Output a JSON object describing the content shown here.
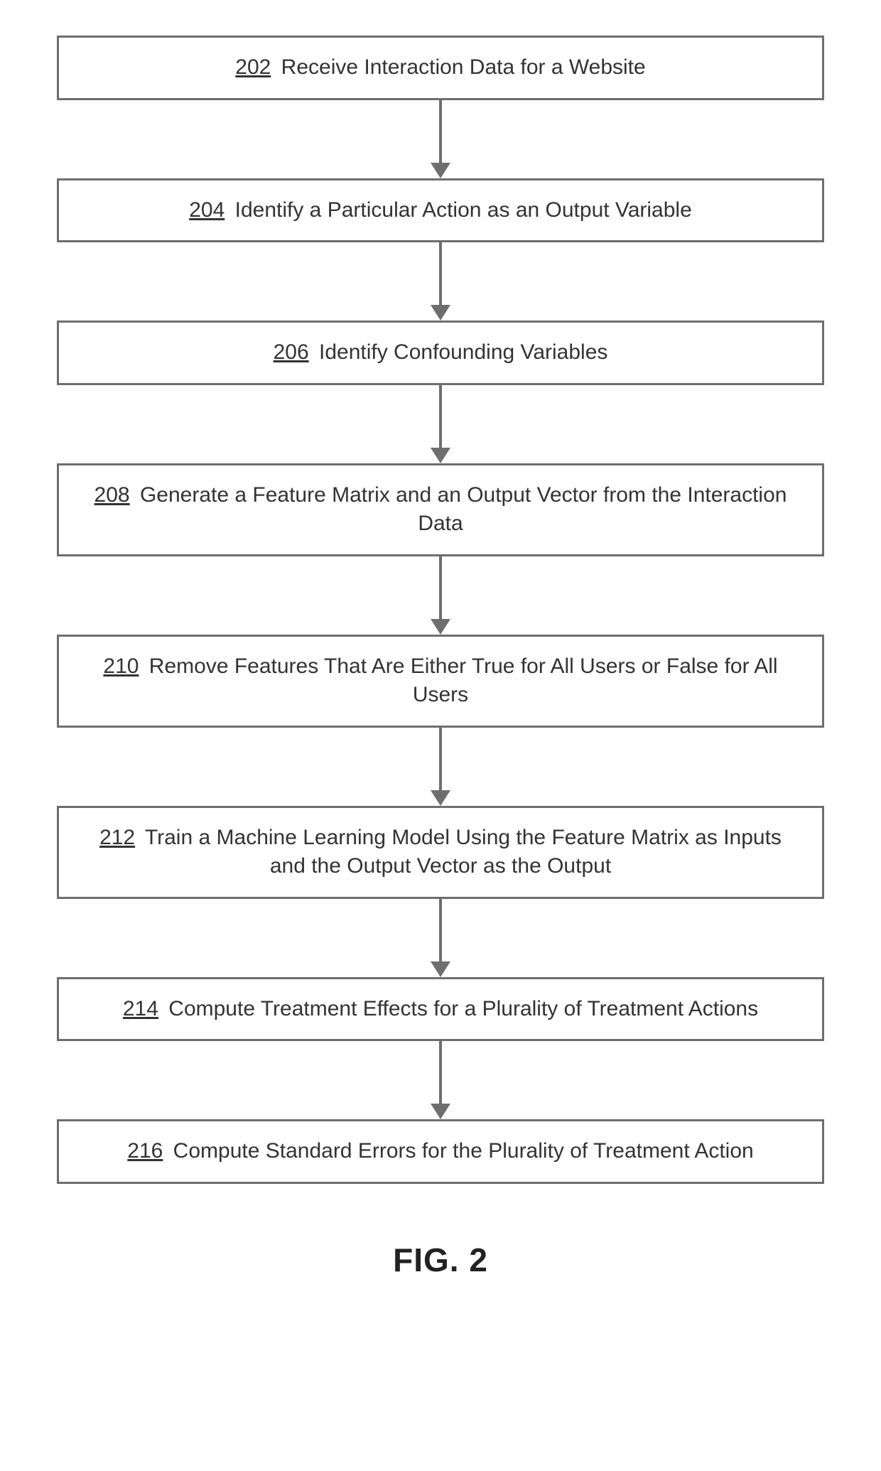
{
  "caption": "FIG. 2",
  "steps": [
    {
      "num": "202",
      "text": "Receive Interaction Data for a Website"
    },
    {
      "num": "204",
      "text": "Identify a Particular Action as an Output Variable"
    },
    {
      "num": "206",
      "text": "Identify Confounding Variables"
    },
    {
      "num": "208",
      "text": "Generate a Feature Matrix and an Output Vector from the Interaction Data"
    },
    {
      "num": "210",
      "text": "Remove Features That Are Either True for All Users or False for All Users"
    },
    {
      "num": "212",
      "text": "Train a Machine Learning Model Using the Feature Matrix as Inputs and the Output Vector as the Output"
    },
    {
      "num": "214",
      "text": "Compute Treatment Effects for a Plurality of Treatment Actions"
    },
    {
      "num": "216",
      "text": "Compute Standard Errors for the Plurality of Treatment Action"
    }
  ]
}
